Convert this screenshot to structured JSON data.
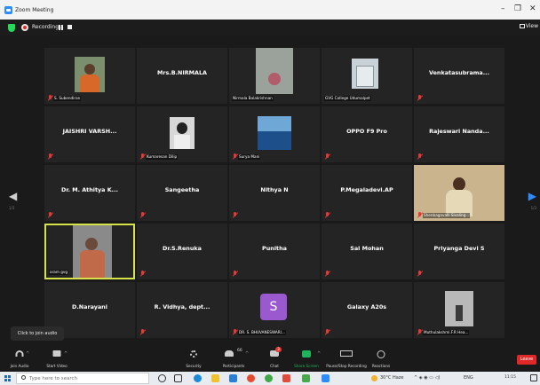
{
  "window": {
    "title": "Zoom Meeting",
    "controls": [
      "–",
      "❐",
      "✕"
    ]
  },
  "status": {
    "recording_label": "Recording...",
    "view_label": "View"
  },
  "tiles": [
    {
      "name": "",
      "caption": "S. Subendiran",
      "muted": true,
      "video": "person-outdoor"
    },
    {
      "name": "Mrs.B.NIRMALA",
      "caption": "",
      "muted": false,
      "video": ""
    },
    {
      "name": "",
      "caption": "Nirmala Balakrishnan",
      "muted": false,
      "video": "room-person"
    },
    {
      "name": "",
      "caption": "GVG College Udumalpet",
      "muted": false,
      "video": "building"
    },
    {
      "name": "Venkatasubrama...",
      "caption": "",
      "muted": true,
      "video": ""
    },
    {
      "name": "JAISHRI VARSH...",
      "caption": "",
      "muted": true,
      "video": ""
    },
    {
      "name": "",
      "caption": "Kumaresan Dilip",
      "muted": true,
      "video": "portrait-photo"
    },
    {
      "name": "",
      "caption": "Surya Mani",
      "muted": true,
      "video": "sea"
    },
    {
      "name": "OPPO F9 Pro",
      "caption": "",
      "muted": true,
      "video": ""
    },
    {
      "name": "Rajeswari Nanda...",
      "caption": "",
      "muted": true,
      "video": ""
    },
    {
      "name": "Dr. M. Athitya K...",
      "caption": "",
      "muted": true,
      "video": ""
    },
    {
      "name": "Sangeetha",
      "caption": "",
      "muted": true,
      "video": ""
    },
    {
      "name": "Nithya N",
      "caption": "",
      "muted": true,
      "video": ""
    },
    {
      "name": "P.Megaladevi.AP",
      "caption": "",
      "muted": true,
      "video": ""
    },
    {
      "name": "",
      "caption": "Shenbagavalli Sivaling...",
      "muted": true,
      "video": "woman-room"
    },
    {
      "name": "",
      "caption": "aram gvg",
      "muted": false,
      "video": "speaker",
      "active": true
    },
    {
      "name": "Dr.S.Renuka",
      "caption": "",
      "muted": true,
      "video": ""
    },
    {
      "name": "Punitha",
      "caption": "",
      "muted": true,
      "video": ""
    },
    {
      "name": "Sal Mohan",
      "caption": "",
      "muted": true,
      "video": ""
    },
    {
      "name": "Priyanga Devi S",
      "caption": "",
      "muted": true,
      "video": ""
    },
    {
      "name": "D.Narayani",
      "caption": "",
      "muted": false,
      "video": ""
    },
    {
      "name": "R. Vidhya, dept...",
      "caption": "",
      "muted": true,
      "video": ""
    },
    {
      "name": "",
      "caption": "DR. S. BHUVANESWARI...",
      "muted": true,
      "video": "avatar",
      "avatar_letter": "S"
    },
    {
      "name": "Galaxy A20s",
      "caption": "",
      "muted": true,
      "video": ""
    },
    {
      "name": "",
      "caption": "Muthulakshmi.F.R Hea...",
      "muted": true,
      "video": "room-figure"
    }
  ],
  "navigation": {
    "left_page": "1/3",
    "right_page": "1/3",
    "prev_arrow": "◀",
    "next_arrow": "▶"
  },
  "tooltip": {
    "text": "Click to join audio"
  },
  "toolbar": {
    "join_audio": "Join Audio",
    "start_video": "Start Video",
    "security": "Security",
    "participants": "Participants",
    "participants_count": "66",
    "chat": "Chat",
    "chat_badge": "3",
    "share_screen": "Share Screen",
    "pause_recording": "Pause/Stop Recording",
    "reactions": "Reactions",
    "leave": "Leave"
  },
  "taskbar": {
    "search_placeholder": "Type here to search",
    "weather": "30°C Haze",
    "language": "ENG",
    "clock": "11:15"
  },
  "colors": {
    "accent_blue": "#2d8cff",
    "tile_bg": "#242424",
    "active_speaker_border": "#d5e24a",
    "muted_red": "#e53935",
    "leave_red": "#e02828",
    "avatar_purple": "#9b59d0"
  }
}
